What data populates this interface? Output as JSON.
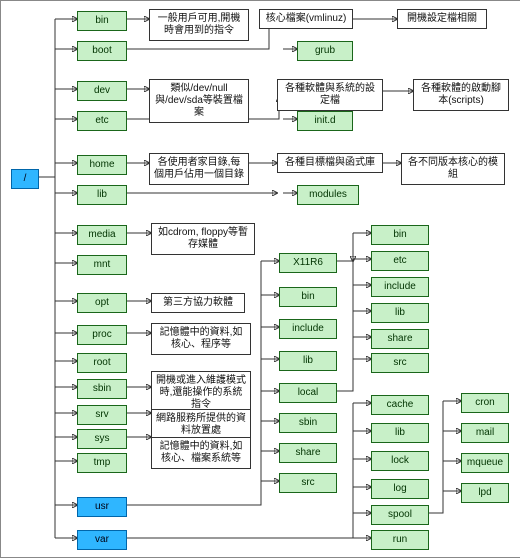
{
  "root": {
    "label": "/"
  },
  "col1": [
    {
      "id": "bin",
      "label": "bin"
    },
    {
      "id": "boot",
      "label": "boot"
    },
    {
      "id": "dev",
      "label": "dev"
    },
    {
      "id": "etc",
      "label": "etc"
    },
    {
      "id": "home",
      "label": "home"
    },
    {
      "id": "lib",
      "label": "lib"
    },
    {
      "id": "media",
      "label": "media"
    },
    {
      "id": "mnt",
      "label": "mnt"
    },
    {
      "id": "opt",
      "label": "opt"
    },
    {
      "id": "proc",
      "label": "proc"
    },
    {
      "id": "root",
      "label": "root"
    },
    {
      "id": "sbin",
      "label": "sbin"
    },
    {
      "id": "srv",
      "label": "srv"
    },
    {
      "id": "sys",
      "label": "sys"
    },
    {
      "id": "tmp",
      "label": "tmp"
    },
    {
      "id": "usr",
      "label": "usr",
      "highlight": true
    },
    {
      "id": "var",
      "label": "var",
      "highlight": true
    }
  ],
  "notes": {
    "bin": "一般用戶可用,開機時會用到的指令",
    "boot": "核心檔案(vmlinuz)",
    "boot2": "開機設定檔相關",
    "dev": "類似/dev/null與/dev/sda等裝置檔案",
    "etc": "各種軟體與系統的設定檔",
    "etc2": "各種軟體的啟動腳本(scripts)",
    "home": "各使用者家目錄,每個用戶佔用一個目錄",
    "home2": "各種目標檔與函式庫",
    "lib": "各不同版本核心的模組",
    "media": "如cdrom, floppy等暫存媒體",
    "opt": "第三方協力軟體",
    "proc": "記憶體中的資料,如核心、程序等",
    "sbin": "開機或進入維護模式時,還能操作的系統指令",
    "srv": "網路服務所提供的資料放置處",
    "sys": "記憶體中的資料,如核心、檔案系統等"
  },
  "etc_children": [
    {
      "label": "grub"
    },
    {
      "label": "init.d"
    }
  ],
  "lib_children": [
    {
      "label": "modules"
    }
  ],
  "usr_children": [
    {
      "label": "X11R6"
    },
    {
      "label": "bin"
    },
    {
      "label": "include"
    },
    {
      "label": "lib"
    },
    {
      "label": "local"
    },
    {
      "label": "sbin"
    },
    {
      "label": "share"
    },
    {
      "label": "src"
    }
  ],
  "usr_local_children": [
    {
      "label": "bin"
    },
    {
      "label": "etc"
    },
    {
      "label": "include"
    },
    {
      "label": "lib"
    },
    {
      "label": "share"
    },
    {
      "label": "src"
    }
  ],
  "var_children": [
    {
      "label": "cache"
    },
    {
      "label": "lib"
    },
    {
      "label": "lock"
    },
    {
      "label": "log"
    },
    {
      "label": "spool"
    },
    {
      "label": "run"
    }
  ],
  "spool_children": [
    {
      "label": "cron"
    },
    {
      "label": "mail"
    },
    {
      "label": "mqueue"
    },
    {
      "label": "lpd"
    }
  ],
  "chart_data": {
    "type": "tree",
    "root": "/",
    "children": {
      "/": [
        "bin",
        "boot",
        "dev",
        "etc",
        "home",
        "lib",
        "media",
        "mnt",
        "opt",
        "proc",
        "root",
        "sbin",
        "srv",
        "sys",
        "tmp",
        "usr",
        "var"
      ],
      "boot": [
        "grub"
      ],
      "etc": [
        "init.d"
      ],
      "lib": [
        "modules"
      ],
      "usr": [
        "X11R6",
        "bin",
        "include",
        "lib",
        "local",
        "sbin",
        "share",
        "src"
      ],
      "usr/local": [
        "bin",
        "etc",
        "include",
        "lib",
        "share",
        "src"
      ],
      "var": [
        "cache",
        "lib",
        "lock",
        "log",
        "spool",
        "run"
      ],
      "var/spool": [
        "cron",
        "mail",
        "mqueue",
        "lpd"
      ]
    },
    "annotations": {
      "bin": "一般用戶可用,開機時會用到的指令",
      "boot": [
        "核心檔案(vmlinuz)",
        "開機設定檔相關"
      ],
      "dev": "類似/dev/null與/dev/sda等裝置檔案",
      "etc": [
        "各種軟體與系統的設定檔",
        "各種軟體的啟動腳本(scripts)"
      ],
      "home": [
        "各使用者家目錄,每個用戶佔用一個目錄",
        "各種目標檔與函式庫"
      ],
      "lib": "各不同版本核心的模組",
      "media": "如cdrom, floppy等暫存媒體",
      "opt": "第三方協力軟體",
      "proc": "記憶體中的資料,如核心、程序等",
      "sbin": "開機或進入維護模式時,還能操作的系統指令",
      "srv": "網路服務所提供的資料放置處",
      "sys": "記憶體中的資料,如核心、檔案系統等"
    }
  }
}
